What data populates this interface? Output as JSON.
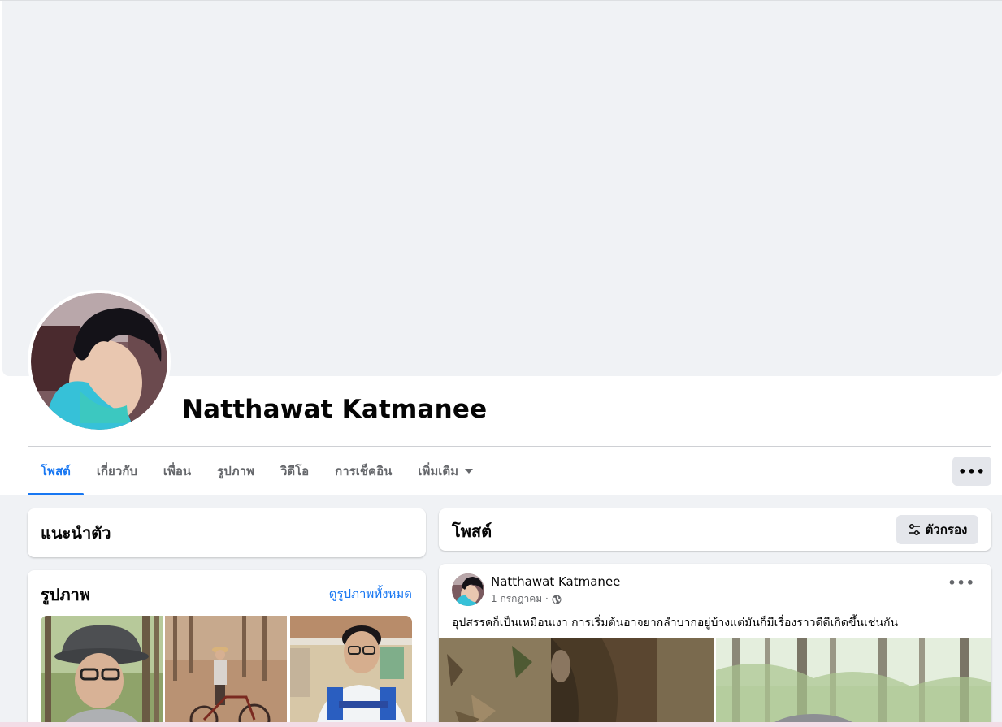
{
  "profile": {
    "name": "Natthawat Katmanee"
  },
  "tabs": [
    {
      "label": "โพสต์",
      "active": true
    },
    {
      "label": "เกี่ยวกับ",
      "active": false
    },
    {
      "label": "เพื่อน",
      "active": false
    },
    {
      "label": "รูปภาพ",
      "active": false
    },
    {
      "label": "วิดีโอ",
      "active": false
    },
    {
      "label": "การเช็คอิน",
      "active": false
    },
    {
      "label": "เพิ่มเติม",
      "active": false
    }
  ],
  "more_button": {
    "label": "•••"
  },
  "intro": {
    "title": "แนะนำตัว"
  },
  "photos": {
    "title": "รูปภาพ",
    "see_all": "ดูรูปภาพทั้งหมด"
  },
  "posts_section": {
    "title": "โพสต์",
    "filter_label": "ตัวกรอง"
  },
  "post": {
    "author": "Natthawat Katmanee",
    "date": "1 กรกฎาคม ·",
    "menu": "•••",
    "text": "อุปสรรคก็เป็นเหมือนเงา การเริ่มต้นอาจยากลำบากอยู่บ้างแต่มันก็มีเรื่องราวดีดีเกิดขึ้นเช่นกัน"
  },
  "colors": {
    "accent": "#1877f2",
    "secondary_text": "#65676b",
    "background": "#f0f2f5",
    "button_gray": "#e4e6eb"
  },
  "icons": {
    "caret": "caret-down-icon",
    "globe": "globe-icon",
    "filter": "filter-icon"
  }
}
